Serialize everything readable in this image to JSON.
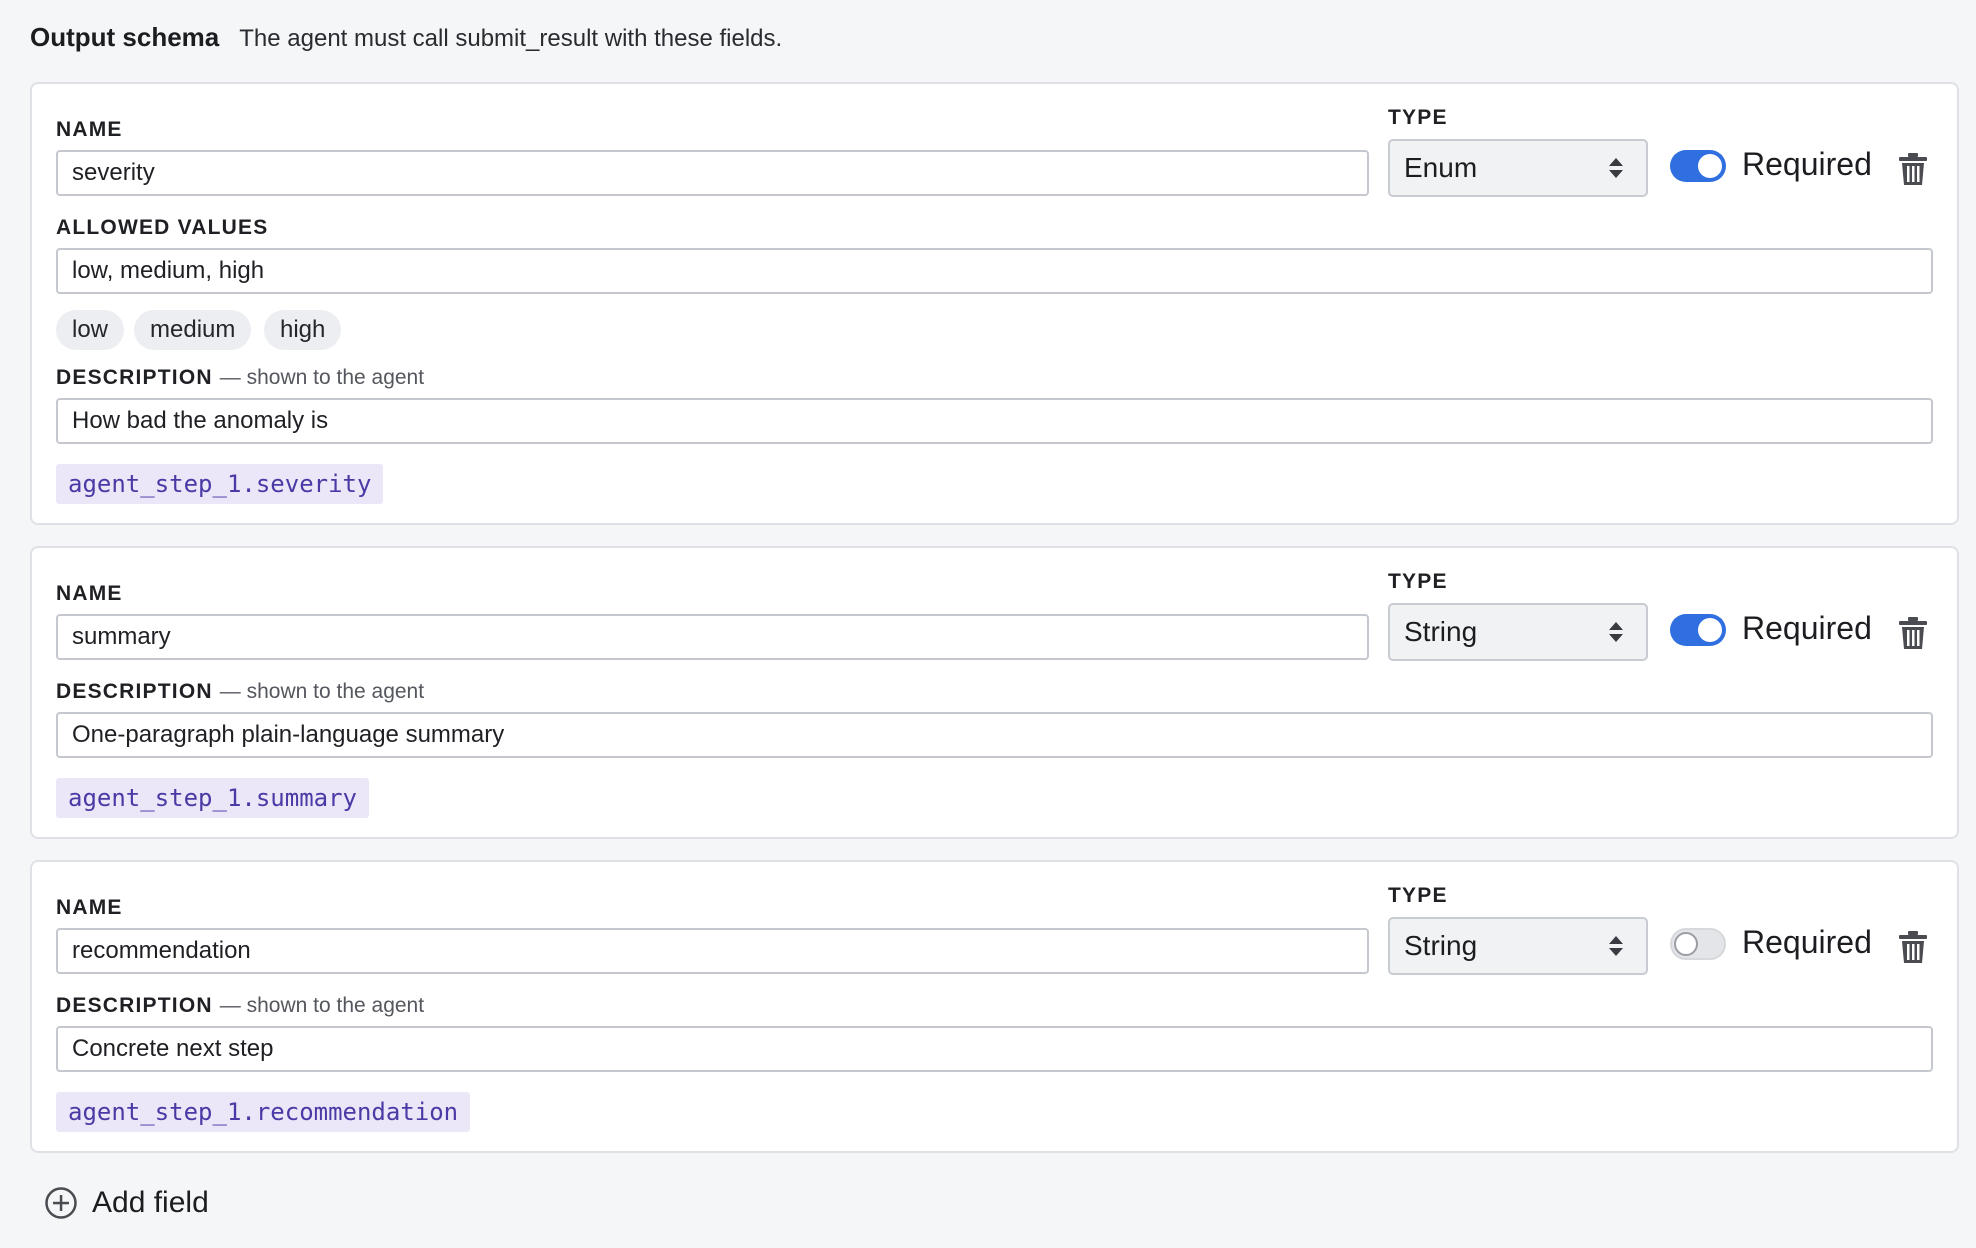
{
  "header": {
    "title": "Output schema",
    "subtitle": "The agent must call submit_result with these fields."
  },
  "labels": {
    "name": "NAME",
    "type": "TYPE",
    "allowed_values": "ALLOWED VALUES",
    "description": "DESCRIPTION",
    "description_hint": "— shown to the agent",
    "required": "Required"
  },
  "fields": [
    {
      "name": "severity",
      "type": "Enum",
      "required": true,
      "allowed_values": "low, medium, high",
      "chips": [
        "low",
        "medium",
        "high"
      ],
      "description": "How bad the anomaly is",
      "reference": "agent_step_1.severity"
    },
    {
      "name": "summary",
      "type": "String",
      "required": true,
      "description": "One-paragraph plain-language summary",
      "reference": "agent_step_1.summary"
    },
    {
      "name": "recommendation",
      "type": "String",
      "required": false,
      "description": "Concrete next step",
      "reference": "agent_step_1.recommendation"
    }
  ],
  "add_field_label": "Add field",
  "colors": {
    "toggle_on": "#2f6fe0",
    "toggle_off": "#e4e5e8",
    "code_bg": "#ebe7f8",
    "code_text": "#4b3aa5",
    "page_bg": "#f5f6f8"
  },
  "icons": {
    "trash": "trash-icon",
    "select_arrows": "updown-arrows-icon",
    "add": "plus-circle-icon"
  }
}
